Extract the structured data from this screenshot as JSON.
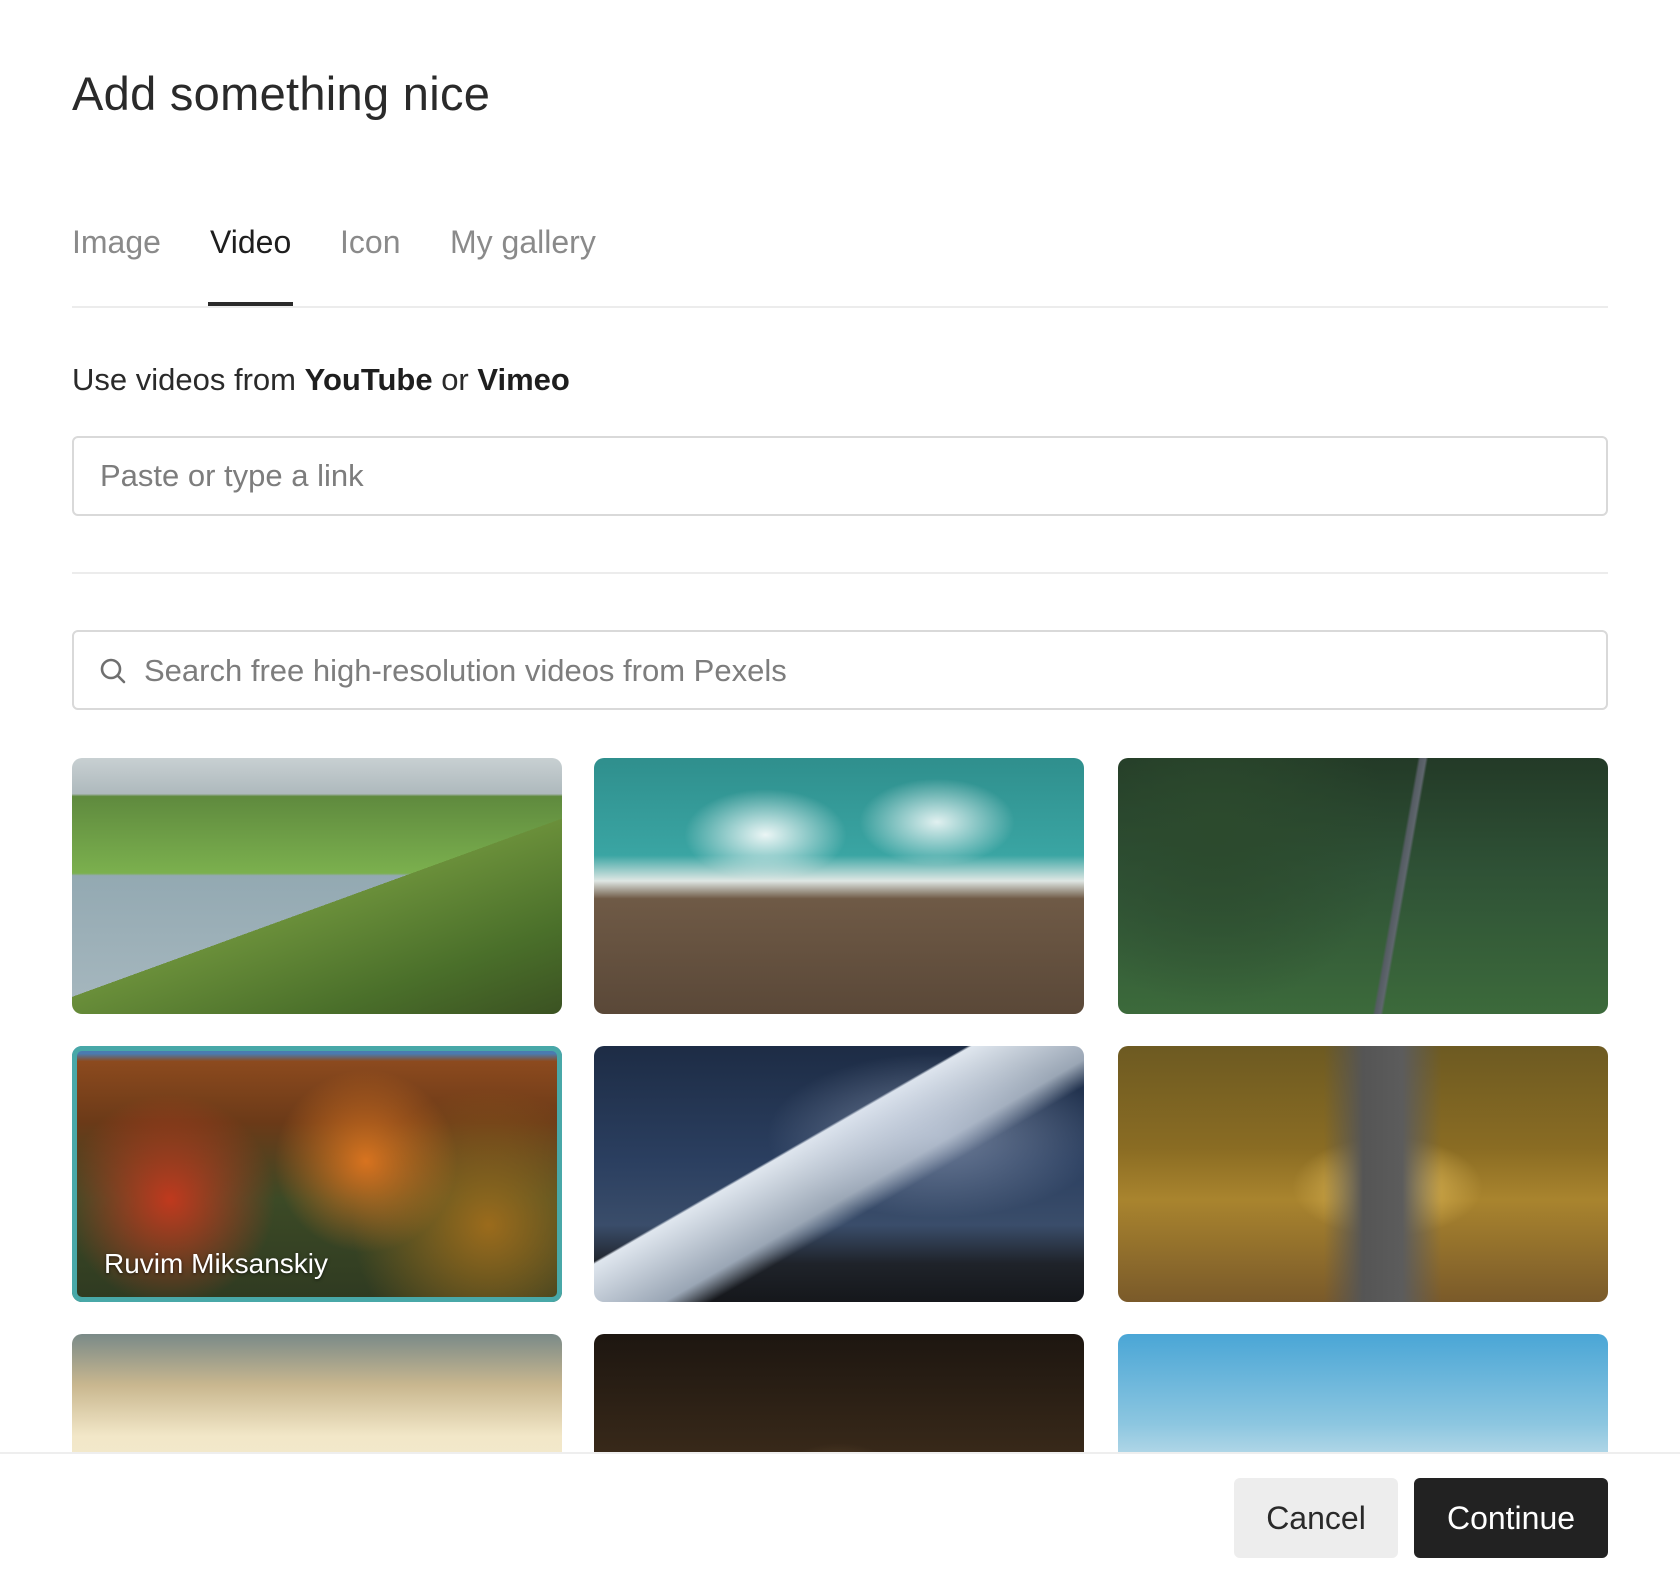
{
  "dialog": {
    "title": "Add something nice"
  },
  "tabs": [
    {
      "label": "Image",
      "active": false
    },
    {
      "label": "Video",
      "active": true
    },
    {
      "label": "Icon",
      "active": false
    },
    {
      "label": "My gallery",
      "active": false
    }
  ],
  "video_source": {
    "prefix": "Use videos from ",
    "youtube": "YouTube",
    "middle": " or ",
    "vimeo": "Vimeo",
    "link_placeholder": "Paste or type a link",
    "link_value": ""
  },
  "search": {
    "placeholder": "Search free high-resolution videos from Pexels",
    "value": "",
    "icon": "search-icon"
  },
  "videos": [
    {
      "scene": "coastal-cliffs",
      "selected": false,
      "author": ""
    },
    {
      "scene": "ocean-waves-rocks",
      "selected": false,
      "author": ""
    },
    {
      "scene": "forest-road",
      "selected": false,
      "author": ""
    },
    {
      "scene": "autumn-forest",
      "selected": true,
      "author": "Ruvim Miksanskiy"
    },
    {
      "scene": "starry-mountain",
      "selected": false,
      "author": ""
    },
    {
      "scene": "autumn-road",
      "selected": false,
      "author": ""
    },
    {
      "scene": "sunset-hills",
      "selected": false,
      "author": ""
    },
    {
      "scene": "night-city",
      "selected": false,
      "author": ""
    },
    {
      "scene": "sky-bay",
      "selected": false,
      "author": ""
    }
  ],
  "colors": {
    "selected_outline": "#48a8a8",
    "primary_button": "#222222",
    "secondary_button": "#ededed"
  },
  "footer": {
    "cancel_label": "Cancel",
    "continue_label": "Continue"
  }
}
